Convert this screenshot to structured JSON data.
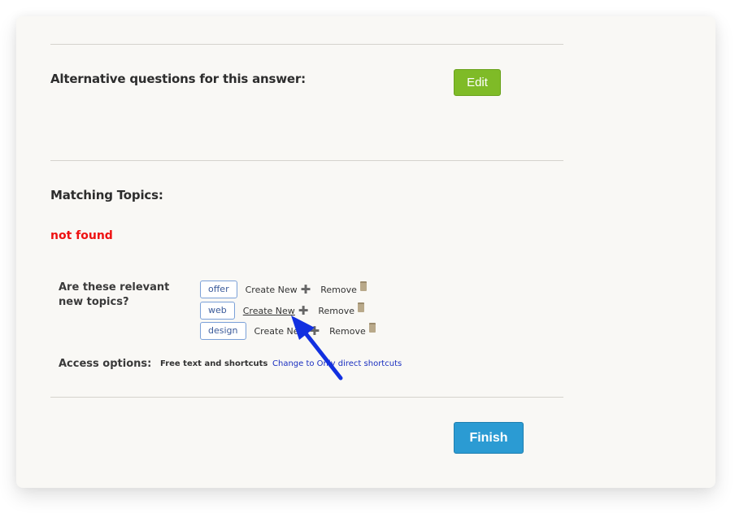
{
  "alternative": {
    "heading": "Alternative questions for this answer:",
    "edit_label": "Edit"
  },
  "matching": {
    "heading": "Matching Topics:",
    "status": "not found",
    "status_color": "#ee1111"
  },
  "topics": {
    "question": "Are these relevant new topics?",
    "items": [
      {
        "tag": "offer",
        "create_label": "Create New",
        "remove_label": "Remove"
      },
      {
        "tag": "web",
        "create_label": "Create New",
        "remove_label": "Remove"
      },
      {
        "tag": "design",
        "create_label": "Create New",
        "remove_label": "Remove"
      }
    ]
  },
  "access": {
    "label": "Access options:",
    "value": "Free text and shortcuts",
    "change_link": "Change to Only direct shortcuts"
  },
  "finish_label": "Finish",
  "colors": {
    "edit": "#7fbb27",
    "finish": "#2b9bd3",
    "annotation_arrow": "#1230e0"
  },
  "annotation": {
    "type": "arrow",
    "points_to": "Create New (web)"
  }
}
